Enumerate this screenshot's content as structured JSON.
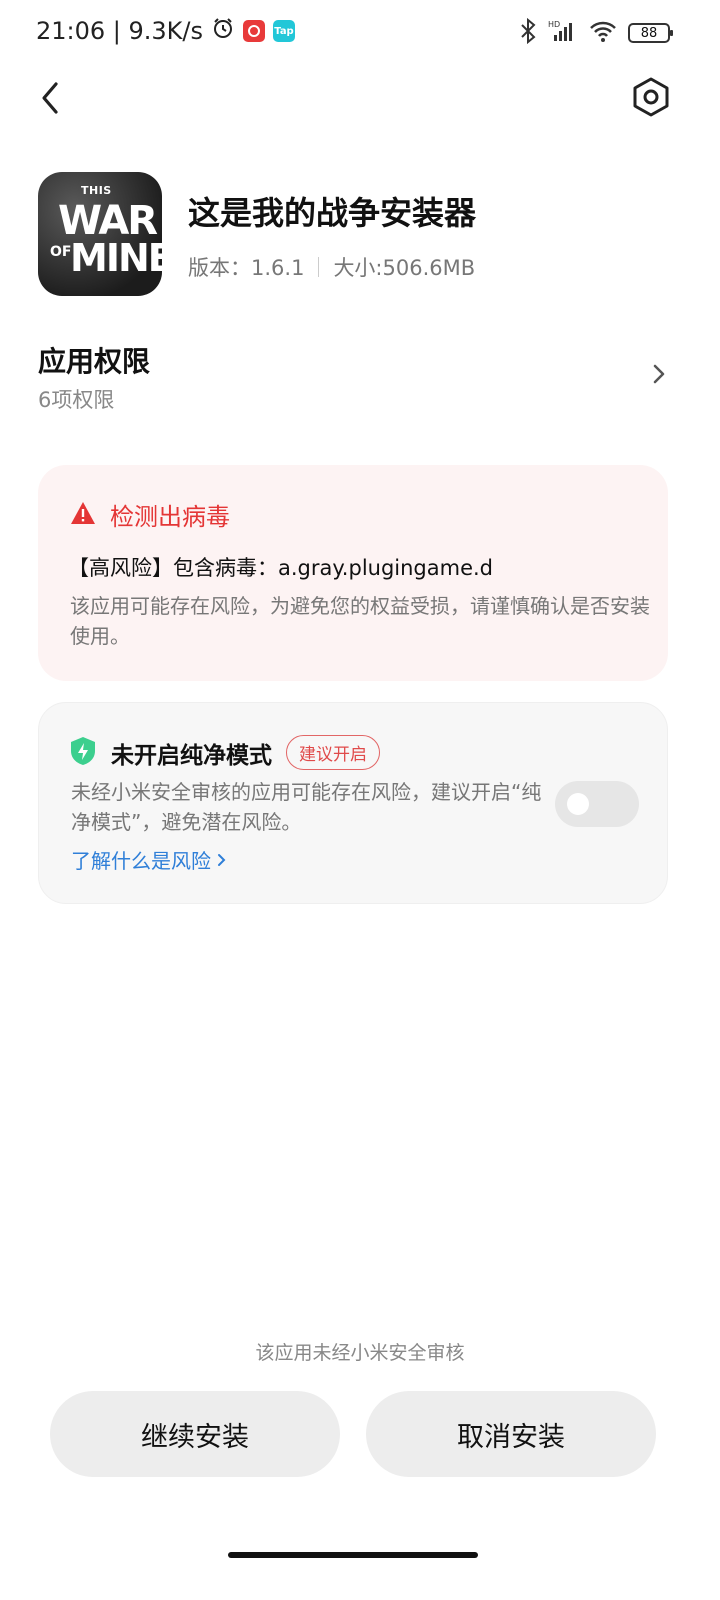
{
  "status_bar": {
    "time_speed": "21:06 | 9.3K/s",
    "tap_badge": "Tap",
    "battery": "88"
  },
  "header": {
    "back_icon": "chevron-left-icon",
    "settings_icon": "hexagon-gear-icon"
  },
  "app": {
    "name": "这是我的战争安装器",
    "version": "版本：1.6.1",
    "size": "大小:506.6MB",
    "icon_text": {
      "this": "THIS",
      "war": "WAR",
      "of": "OF",
      "mine": "MINE"
    }
  },
  "permissions": {
    "title": "应用权限",
    "count": "6项权限"
  },
  "virus_alert": {
    "title": "检测出病毒",
    "risk_line": "【高风险】包含病毒：a.gray.plugingame.d",
    "description": "该应用可能存在风险，为避免您的权益受损，请谨慎确认是否安装使用。",
    "accent": "#e43535"
  },
  "pure_mode": {
    "title": "未开启纯净模式",
    "badge": "建议开启",
    "description": "未经小米安全审核的应用可能存在风险，建议开启“纯净模式”，避免潜在风险。",
    "link": "了解什么是风险",
    "toggle_on": false
  },
  "footer": {
    "note": "该应用未经小米安全审核",
    "continue_label": "继续安装",
    "cancel_label": "取消安装"
  }
}
